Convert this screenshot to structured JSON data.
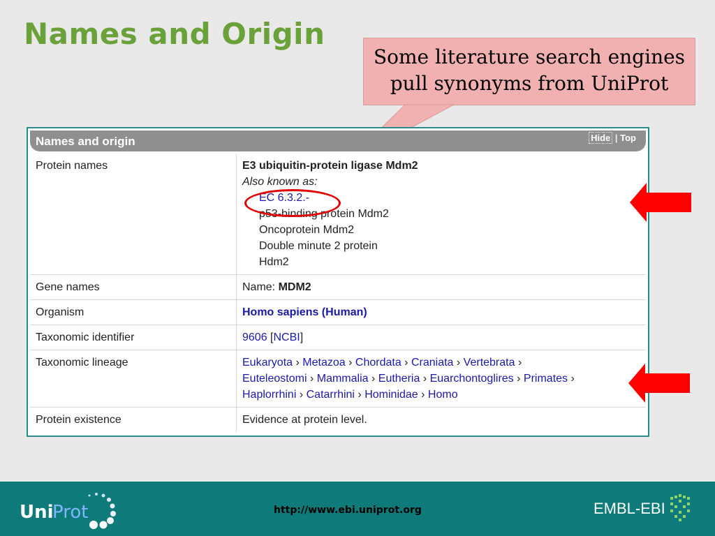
{
  "slide": {
    "title": "Names and Origin"
  },
  "callout": {
    "line1": "Some literature search engines",
    "line2": "pull synonyms from UniProt"
  },
  "panel": {
    "title": "Names and origin",
    "hide_label": "Hide",
    "separator": "|",
    "top_label": "Top",
    "rows": {
      "protein_names": {
        "label": "Protein names",
        "recommended": "E3 ubiquitin-protein ligase Mdm2",
        "also_known_as": "Also known as:",
        "synonyms": [
          "EC 6.3.2.-",
          "p53-binding protein Mdm2",
          "Oncoprotein Mdm2",
          "Double minute 2 protein",
          "Hdm2"
        ]
      },
      "gene_names": {
        "label": "Gene names",
        "prefix": "Name:",
        "value": "MDM2"
      },
      "organism": {
        "label": "Organism",
        "value": "Homo sapiens (Human)"
      },
      "taxonomic_identifier": {
        "label": "Taxonomic identifier",
        "id": "9606",
        "source_open": "[",
        "source": "NCBI",
        "source_close": "]"
      },
      "taxonomic_lineage": {
        "label": "Taxonomic lineage",
        "taxa": [
          "Eukaryota",
          "Metazoa",
          "Chordata",
          "Craniata",
          "Vertebrata",
          "Euteleostomi",
          "Mammalia",
          "Eutheria",
          "Euarchontoglires",
          "Primates",
          "Haplorrhini",
          "Catarrhini",
          "Hominidae",
          "Homo"
        ],
        "separator": "›"
      },
      "protein_existence": {
        "label": "Protein existence",
        "value": "Evidence at protein level."
      }
    }
  },
  "footer": {
    "url": "http://www.ebi.uniprot.org",
    "uniprot_logo": {
      "part1": "Uni",
      "part2": "Prot"
    },
    "embl_logo": "EMBL-EBI"
  },
  "colors": {
    "title_green": "#6ba13a",
    "callout_pink": "#f2b1b1",
    "panel_border": "#2a8a8a",
    "link_blue": "#1a1aa6",
    "arrow_red": "#ff0000",
    "footer_teal": "#0f7a7a"
  },
  "icons": [
    "red-arrow-left-icon",
    "uniprot-logo",
    "embl-ebi-logo"
  ]
}
